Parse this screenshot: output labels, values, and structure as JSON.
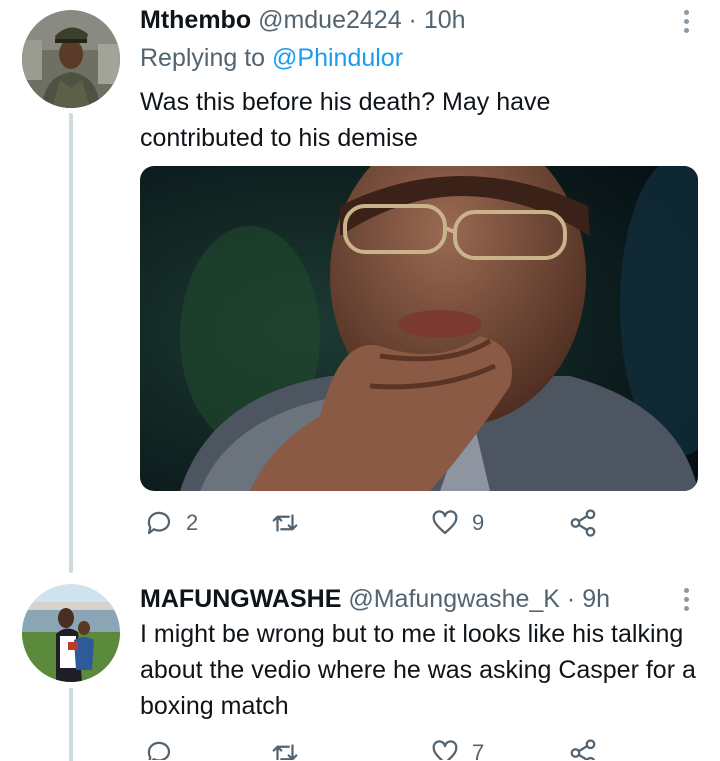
{
  "tweets": [
    {
      "name": "Mthembo",
      "handle": "@mdue2424",
      "separator": "·",
      "time": "10h",
      "replying_prefix": "Replying to ",
      "replying_to": "@Phindulor",
      "text": "Was this before his death? May have contributed to his demise",
      "replies": "2",
      "retweets": "",
      "likes": "9"
    },
    {
      "name": "MAFUNGWASHE",
      "handle": "@Mafungwashe_K",
      "separator": "·",
      "time": "9h",
      "text": "I might be wrong but to me it looks like his talking about the vedio where he was asking Casper for a boxing match",
      "replies": "",
      "retweets": "",
      "likes": "7"
    }
  ],
  "colors": {
    "text": "#0f1419",
    "secondary": "#536471",
    "accent": "#1d9bf0",
    "thread_line": "#cfd9de"
  },
  "icons": [
    "more-icon",
    "reply-icon",
    "retweet-icon",
    "like-icon",
    "share-icon"
  ]
}
